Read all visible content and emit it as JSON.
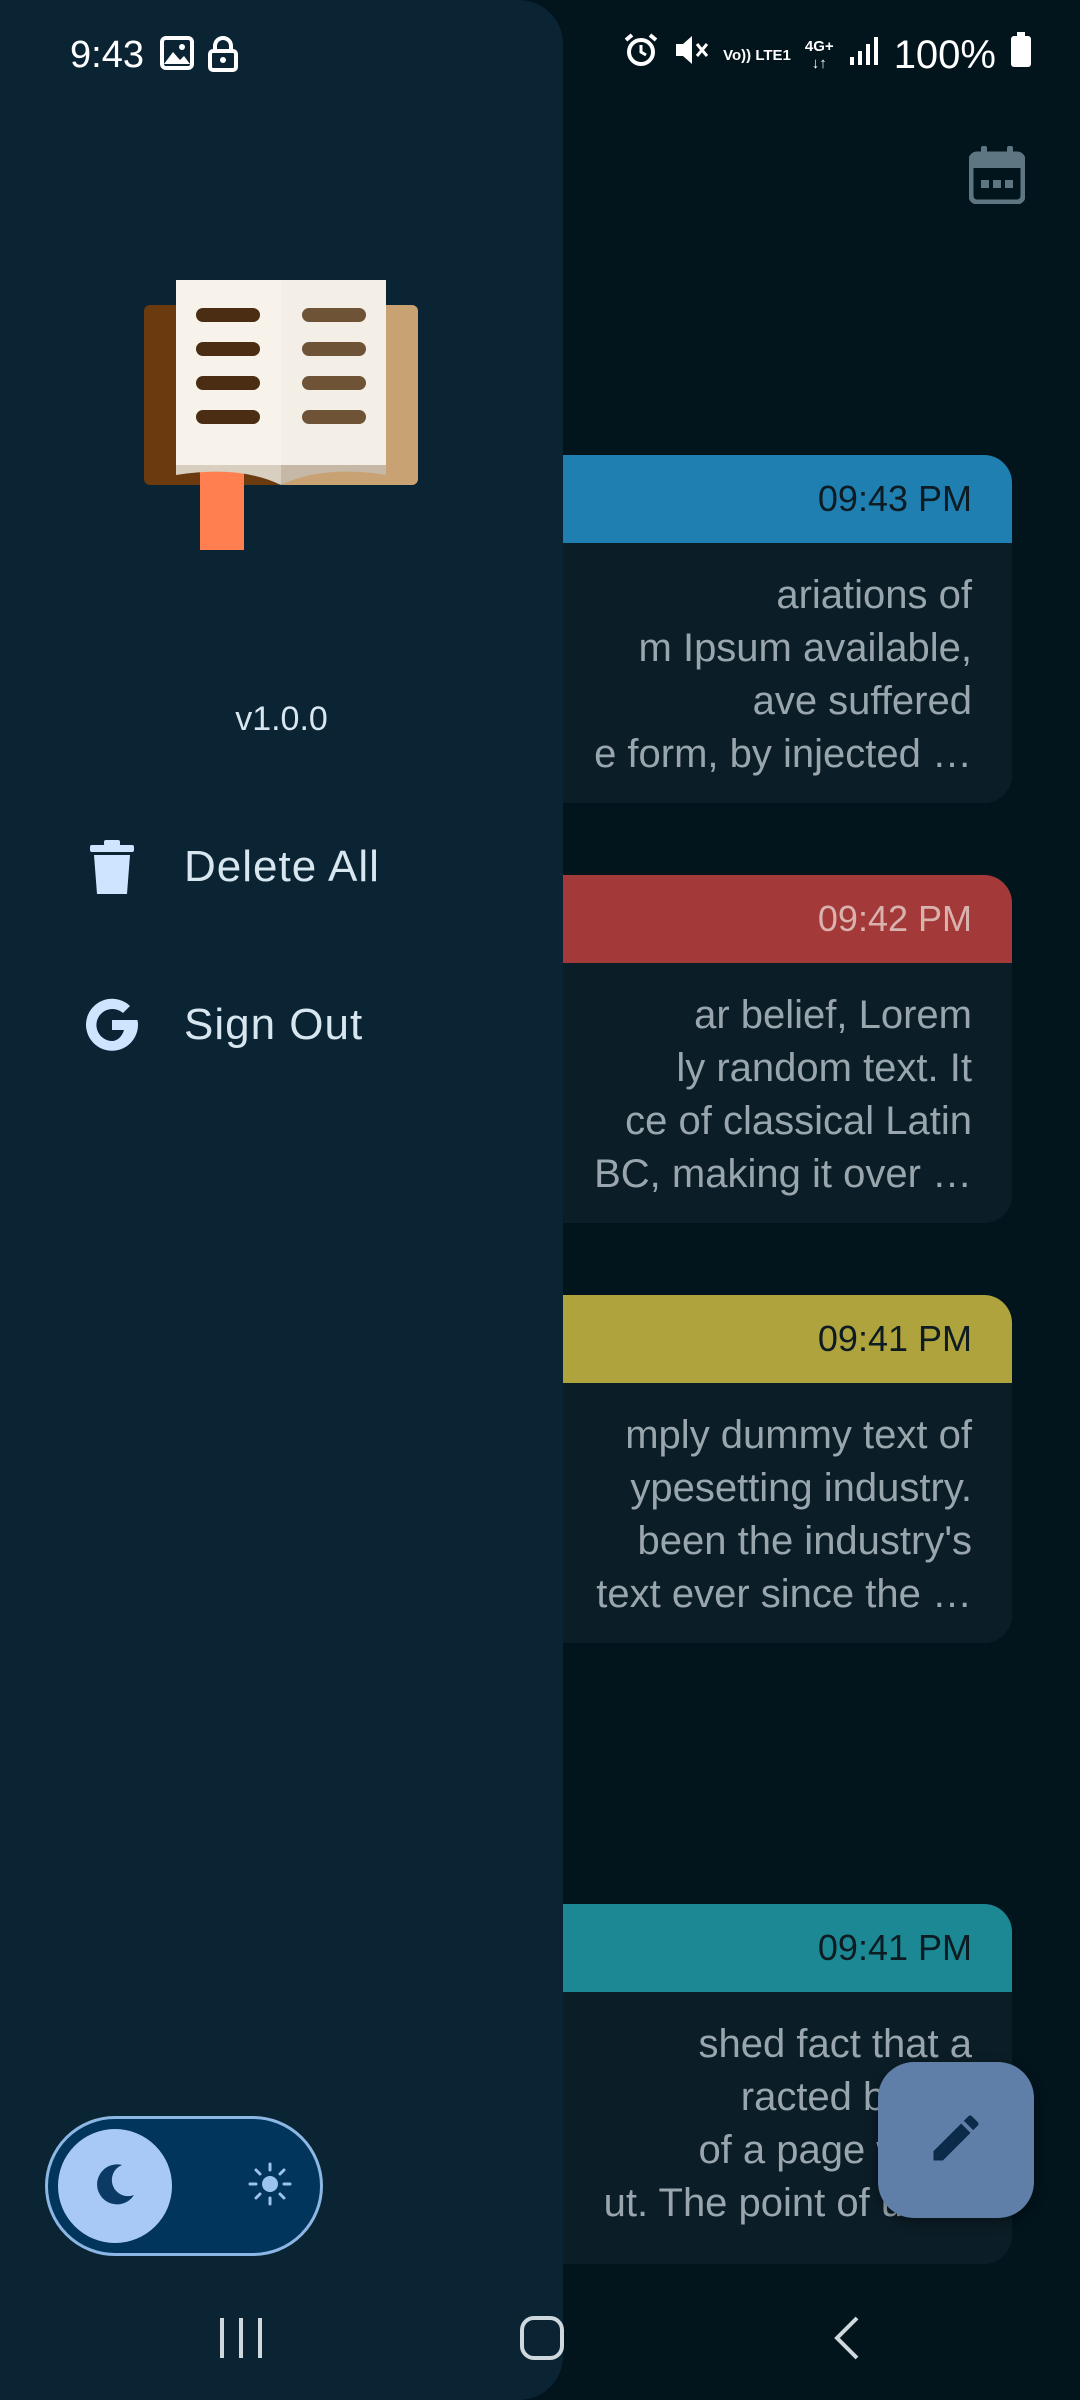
{
  "status_bar": {
    "time": "9:43",
    "left_icons": [
      "image-icon",
      "lock-icon"
    ],
    "right_icons": [
      "alarm-icon",
      "mute-icon",
      "volte-icon",
      "4g-icon",
      "signal-icon"
    ],
    "battery_text": "100%",
    "volte_label": "Vo)) LTE1",
    "network_label": "4G+"
  },
  "drawer": {
    "version": "v1.0.0",
    "items": [
      {
        "label": "Delete All",
        "icon": "trash-icon"
      },
      {
        "label": "Sign Out",
        "icon": "google-icon"
      }
    ],
    "theme_toggle": {
      "selected": "dark"
    }
  },
  "notes": [
    {
      "time": "09:43 PM",
      "color": "#1f7fb1",
      "header_text_color": "#0d1b22",
      "text": "ariations of\nm Ipsum available,\nave suffered\ne form, by injected …"
    },
    {
      "time": "09:42 PM",
      "color": "#a33a39",
      "header_text_color": "#d9b2ad",
      "text": "ar belief, Lorem\nly random text. It\nce of classical Latin\nBC, making it over …"
    },
    {
      "time": "09:41 PM",
      "color": "#afa33d",
      "header_text_color": "#0d1b22",
      "text": "mply dummy text of\nypesetting industry.\nbeen the industry's\ntext ever since the …"
    },
    {
      "time": "09:41 PM",
      "color": "#1b8894",
      "header_text_color": "#0d1b22",
      "text": "shed fact that a\nracted by the\nof a page when\nut. The point of usi…"
    }
  ],
  "colors": {
    "background": "#02141c",
    "drawer": "#0a2433",
    "accent": "#a8c9f6",
    "fab": "#5f7fa8"
  }
}
